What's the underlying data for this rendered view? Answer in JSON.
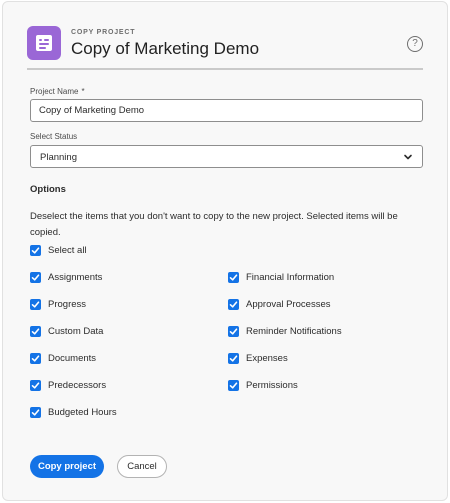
{
  "dialog": {
    "eyebrow": "COPY PROJECT",
    "title": "Copy of Marketing Demo",
    "help_icon": "help-circle-icon",
    "help_glyph": "?",
    "app_icon": "project-sheet-icon"
  },
  "form": {
    "project_name": {
      "label": "Project Name",
      "required_marker": "*",
      "value": "Copy of Marketing Demo"
    },
    "status": {
      "label": "Select Status",
      "value": "Planning"
    }
  },
  "options": {
    "heading": "Options",
    "instructions": "Deselect the items that you don't want to copy to the new project. Selected items will be copied.",
    "select_all": {
      "label": "Select all",
      "checked": true
    },
    "left_column": [
      {
        "label": "Assignments",
        "checked": true
      },
      {
        "label": "Progress",
        "checked": true
      },
      {
        "label": "Custom Data",
        "checked": true
      },
      {
        "label": "Documents",
        "checked": true
      },
      {
        "label": "Predecessors",
        "checked": true
      },
      {
        "label": "Budgeted Hours",
        "checked": true
      }
    ],
    "right_column": [
      {
        "label": "Financial Information",
        "checked": true
      },
      {
        "label": "Approval Processes",
        "checked": true
      },
      {
        "label": "Reminder Notifications",
        "checked": true
      },
      {
        "label": "Expenses",
        "checked": true
      },
      {
        "label": "Permissions",
        "checked": true
      }
    ]
  },
  "actions": {
    "primary_label": "Copy project",
    "secondary_label": "Cancel"
  },
  "colors": {
    "accent": "#1473e6",
    "app_icon": "#9a67d6"
  }
}
